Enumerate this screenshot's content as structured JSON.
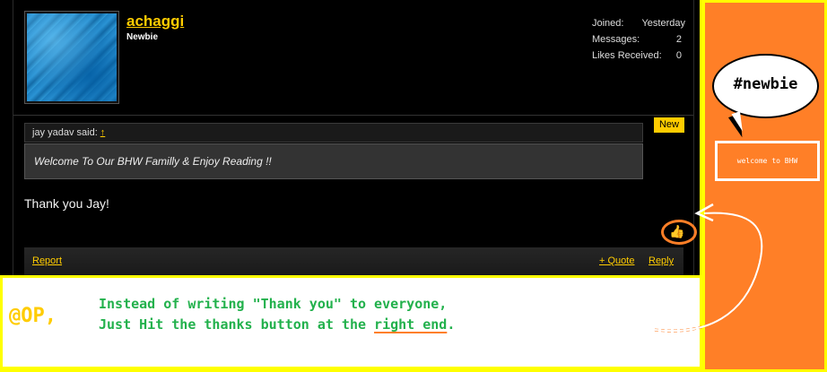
{
  "user": {
    "name": "achaggi",
    "title": "Newbie",
    "stats": [
      {
        "label": "Joined:",
        "value": "Yesterday"
      },
      {
        "label": "Messages:",
        "value": "2"
      },
      {
        "label": "Likes Received:",
        "value": "0"
      }
    ]
  },
  "post": {
    "badge": "New",
    "quote_author": "jay yadav said:",
    "quote_link": "↑",
    "quote_text": "Welcome To Our BHW Familly & Enjoy Reading !!",
    "message": "Thank you Jay!",
    "like_icon": "thumbs-up-icon",
    "actions": {
      "report": "Report",
      "quote": "+ Quote",
      "reply": "Reply"
    }
  },
  "sidebar": {
    "bubble": "#newbie",
    "welcome": "welcome to BHW"
  },
  "annotation": {
    "prefix": "@OP,",
    "line1": "Instead of writing \"Thank you\" to everyone,",
    "line2_start": "Just Hit the thanks button at the ",
    "line2_highlight": "right end",
    "line2_end": "."
  },
  "colors": {
    "accent": "#ffcc00",
    "annotation_orange": "#ff7f27",
    "annotation_green": "#22b14c",
    "frame": "#ffff00"
  }
}
